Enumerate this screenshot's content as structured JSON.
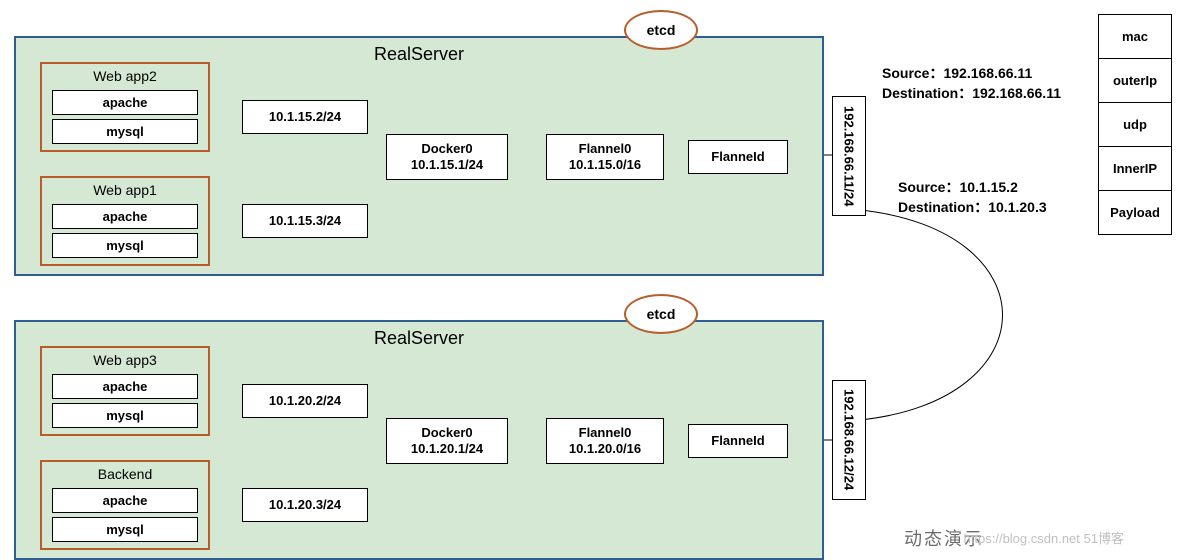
{
  "servers": [
    {
      "title": "RealServer",
      "groups": [
        {
          "title": "Web app2",
          "items": [
            "apache",
            "mysql"
          ],
          "ip": "10.1.15.2/24"
        },
        {
          "title": "Web app1",
          "items": [
            "apache",
            "mysql"
          ],
          "ip": "10.1.15.3/24"
        }
      ],
      "docker": {
        "name": "Docker0",
        "ip": "10.1.15.1/24"
      },
      "flannel0": {
        "name": "Flannel0",
        "ip": "10.1.15.0/16"
      },
      "flanneld": "FlanneId",
      "etcd": "etcd",
      "nic": "192.168.66.11/24"
    },
    {
      "title": "RealServer",
      "groups": [
        {
          "title": "Web app3",
          "items": [
            "apache",
            "mysql"
          ],
          "ip": "10.1.20.2/24"
        },
        {
          "title": "Backend",
          "items": [
            "apache",
            "mysql"
          ],
          "ip": "10.1.20.3/24"
        }
      ],
      "docker": {
        "name": "Docker0",
        "ip": "10.1.20.1/24"
      },
      "flannel0": {
        "name": "Flannel0",
        "ip": "10.1.20.0/16"
      },
      "flanneld": "FlanneId",
      "etcd": "etcd",
      "nic": "192.168.66.12/24"
    }
  ],
  "packet_outer": {
    "source_label": "Source：",
    "source": "192.168.66.11",
    "dest_label": "Destination：",
    "dest": "192.168.66.11"
  },
  "packet_inner": {
    "source_label": "Source：",
    "source": "10.1.15.2",
    "dest_label": "Destination：",
    "dest": "10.1.20.3"
  },
  "stack": [
    "mac",
    "outerIp",
    "udp",
    "InnerIP",
    "Payload"
  ],
  "watermark": "https://blog.csdn.net",
  "watermark_cn": "动态演示",
  "watermark_suffix": "51博客"
}
